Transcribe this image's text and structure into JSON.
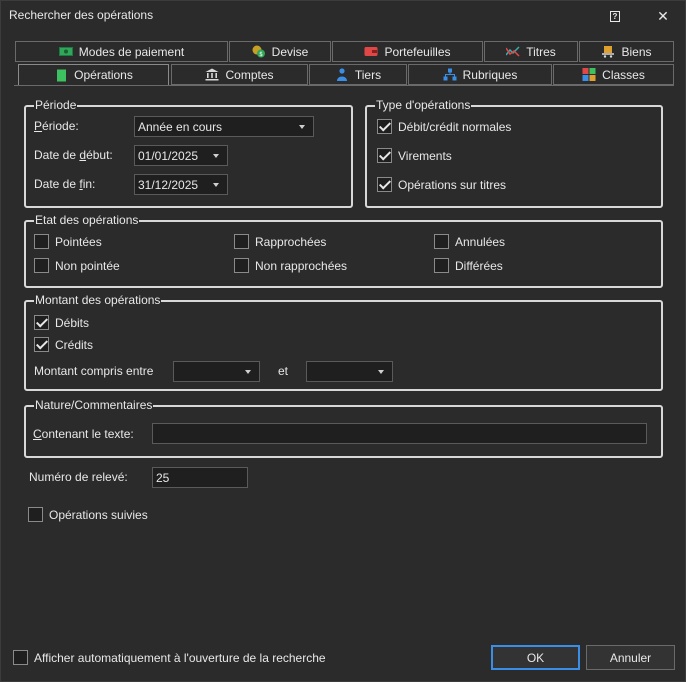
{
  "window": {
    "title": "Rechercher des opérations",
    "help_glyph": "?",
    "close_glyph": "✕"
  },
  "tabs_row1": [
    {
      "label": "Modes de paiement",
      "icon": "banknote-icon",
      "color": "#2fa85a"
    },
    {
      "label": "Devise",
      "icon": "currency-coins-icon",
      "color": "#c8a028"
    },
    {
      "label": "Portefeuilles",
      "icon": "wallet-icon",
      "color": "#e04848"
    },
    {
      "label": "Titres",
      "icon": "stock-chart-icon",
      "color": "#35b0b0"
    },
    {
      "label": "Biens",
      "icon": "cart-icon",
      "color": "#e0a030"
    }
  ],
  "tabs_row2": [
    {
      "label": "Opérations",
      "icon": "document-icon",
      "color": "#3cc060",
      "active": true
    },
    {
      "label": "Comptes",
      "icon": "bank-icon",
      "color": "#d8d8d8"
    },
    {
      "label": "Tiers",
      "icon": "person-icon",
      "color": "#3a8ee6"
    },
    {
      "label": "Rubriques",
      "icon": "hierarchy-icon",
      "color": "#3a8ee6"
    },
    {
      "label": "Classes",
      "icon": "grid-squares-icon",
      "color": "#e04848"
    }
  ],
  "periode": {
    "title": "Période",
    "periode_label_a": "P",
    "periode_label_b": "ériode:",
    "periode_value": "Année en cours",
    "debut_label_a": "Date de ",
    "debut_label_b": "d",
    "debut_label_c": "ébut:",
    "debut_value": "01/01/2025",
    "fin_label_a": "Date de ",
    "fin_label_b": "f",
    "fin_label_c": "in:",
    "fin_value": "31/12/2025"
  },
  "type_operations": {
    "title": "Type d'opérations",
    "items": [
      {
        "label": "Débit/crédit normales",
        "checked": true
      },
      {
        "label": "Virements",
        "checked": true
      },
      {
        "label": "Opérations sur titres",
        "checked": true
      }
    ]
  },
  "etat": {
    "title": "Etat des opérations",
    "items": [
      {
        "label": "Pointées",
        "checked": false
      },
      {
        "label": "Rapprochées",
        "checked": false
      },
      {
        "label": "Annulées",
        "checked": false
      },
      {
        "label": "Non pointée",
        "checked": false
      },
      {
        "label": "Non rapprochées",
        "checked": false
      },
      {
        "label": "Différées",
        "checked": false
      }
    ]
  },
  "montant": {
    "title": "Montant des opérations",
    "debits": "Débits",
    "debits_checked": true,
    "credits": "Crédits",
    "credits_checked": true,
    "range_label": "Montant compris entre",
    "et_label": "et",
    "min_value": "",
    "max_value": ""
  },
  "nature": {
    "title": "Nature/Commentaires",
    "contenant_a": "C",
    "contenant_b": "ontenant le texte:",
    "value": ""
  },
  "releve": {
    "label": "Numéro de relevé:",
    "value": "25"
  },
  "suivies": {
    "label": "Opérations suivies",
    "checked": false
  },
  "footer": {
    "auto_label": "Afficher automatiquement à l'ouverture de la recherche",
    "auto_checked": false,
    "ok": "OK",
    "cancel": "Annuler"
  }
}
